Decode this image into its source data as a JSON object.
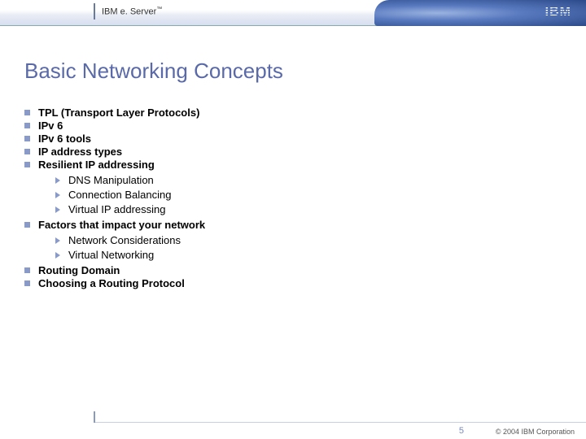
{
  "header": {
    "brand_prefix": "IBM e. Server",
    "brand_tm": "™",
    "logo_name": "IBM"
  },
  "title": "Basic Networking Concepts",
  "bullets": [
    {
      "text": "TPL (Transport Layer Protocols)"
    },
    {
      "text": "IPv 6"
    },
    {
      "text": "IPv 6 tools"
    },
    {
      "text": "IP address types"
    },
    {
      "text": "Resilient IP addressing",
      "children": [
        "DNS Manipulation",
        "Connection Balancing",
        "Virtual IP addressing"
      ]
    },
    {
      "text": "Factors that impact your network",
      "children": [
        "Network Considerations",
        "Virtual Networking"
      ]
    },
    {
      "text": "Routing Domain"
    },
    {
      "text": "Choosing a Routing Protocol"
    }
  ],
  "footer": {
    "page": "5",
    "copyright": "© 2004 IBM Corporation"
  }
}
